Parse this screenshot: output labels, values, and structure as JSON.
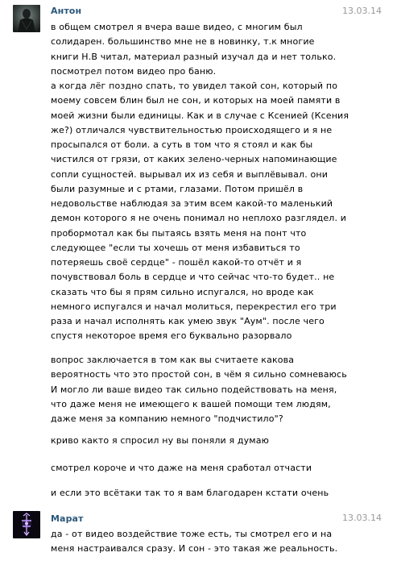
{
  "messages": [
    {
      "author": "Антон",
      "date": "13.03.14",
      "lines": [
        "в общем смотрел я вчера ваше видео, с многим был",
        "солидарен. большинство мне не в новинку, т.к многие",
        "книги Н.В читал, материал разный изучал да и нет только.",
        "посмотрел потом видео про баню.",
        "а когда лёг поздно спать, то увидел такой сон, который по",
        "моему совсем блин был не сон, и которых на моей памяти в",
        "моей жизни были единицы. Как и в случае с Ксенией (Ксения",
        "же?) отличался чувствительностью происходящего и я не",
        "просыпался от боли. а суть в том что я стоял и как бы",
        "чистился от грязи, от каких зелено-черных напоминающие",
        "сопли сущностей. вырывал их из себя и выплёвывал. они",
        "были разумные и с ртами, глазами. Потом пришёл в",
        "недовольстве наблюдая за этим всем какой-то маленький",
        "демон которого я не очень понимал но неплохо разглядел. и",
        "пробормотал как бы пытаясь взять меня на понт что",
        "следующее \"если ты хочешь от меня избавиться то",
        "потеряешь своё сердце\" - пошёл какой-то отчёт и я",
        "почувствовал боль в сердце и что сейчас что-то будет.. не",
        "сказать что бы я прям сильно испугался, но вроде как",
        "немного испугался и начал молиться, перекрестил его три",
        "раза и начал исполнять как умею звук \"Аум\". после чего",
        "спустя некоторое время его буквально разорвало"
      ],
      "para2": [
        "вопрос заключается в том как вы считаете какова",
        "вероятность что это простой сон, в чём я сильно сомневаюсь",
        "И могло ли ваше видео так сильно подействовать на меня,",
        "что даже меня не имеющего к вашей помощи тем людям,",
        "даже меня за компанию немного \"подчистило\"?"
      ],
      "para3": "криво както я спросил ну вы поняли я думаю",
      "para4": "смотрел короче и что даже на меня сработал отчасти",
      "para5": "и если это всётаки так то я вам благодарен кстати очень"
    },
    {
      "author": "Марат",
      "date": "13.03.14",
      "lines": [
        "да - от видео воздействие тоже есть, ты смотрел его и на",
        "меня настраивался сразу. И сон - это такая же реальность."
      ]
    }
  ]
}
